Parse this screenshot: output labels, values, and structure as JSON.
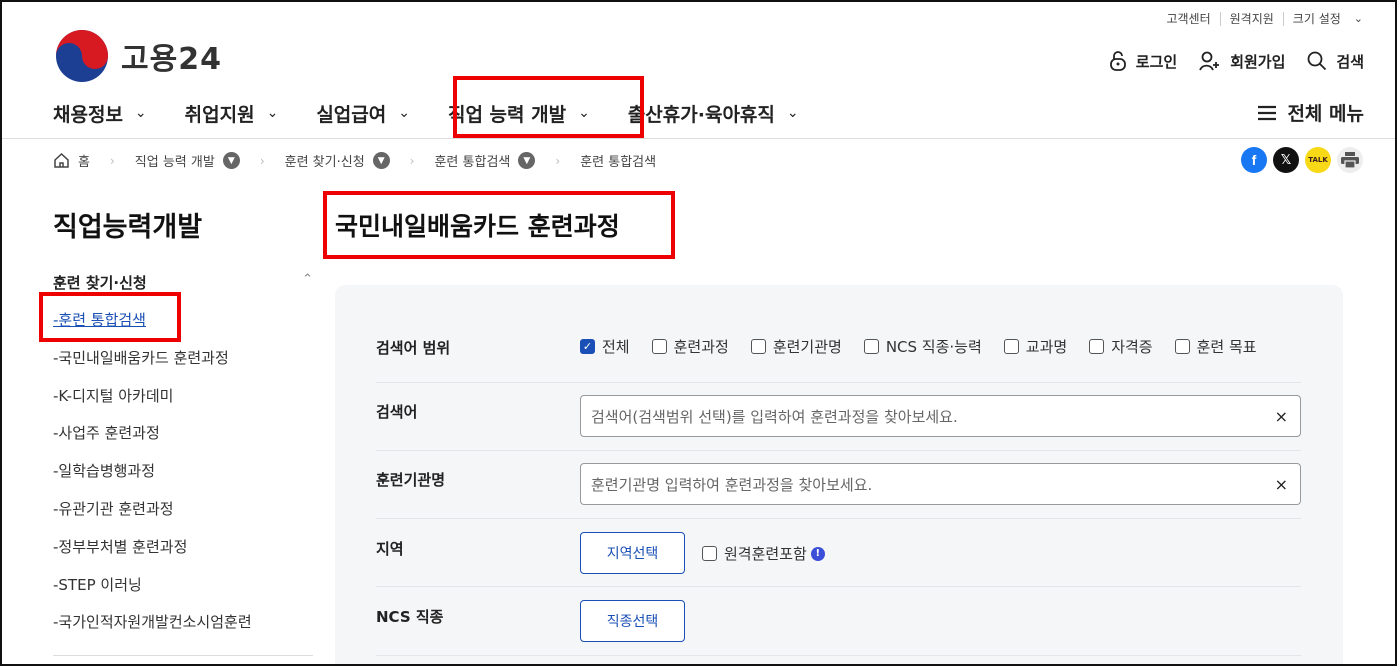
{
  "util": {
    "customer_center": "고객센터",
    "remote_support": "원격지원",
    "size_setting": "크기 설정"
  },
  "logo": {
    "text": "고용24"
  },
  "top_actions": {
    "login": "로그인",
    "signup": "회원가입",
    "search": "검색"
  },
  "gnb": {
    "items": [
      {
        "label": "채용정보"
      },
      {
        "label": "취업지원"
      },
      {
        "label": "실업급여"
      },
      {
        "label": "직업 능력 개발"
      },
      {
        "label": "출산휴가·육아휴직"
      }
    ],
    "all_menu": "전체 메뉴"
  },
  "breadcrumb": {
    "home": "홈",
    "items": [
      "직업 능력 개발",
      "훈련 찾기·신청",
      "훈련 통합검색",
      "훈련 통합검색"
    ]
  },
  "share": {
    "kakao_label": "TALK"
  },
  "lnb": {
    "title": "직업능력개발",
    "section": "훈련 찾기·신청",
    "items": [
      {
        "label": "-훈련 통합검색"
      },
      {
        "label": "-국민내일배움카드 훈련과정"
      },
      {
        "label": "-K-디지털 아카데미"
      },
      {
        "label": "-사업주 훈련과정"
      },
      {
        "label": "-일학습병행과정"
      },
      {
        "label": "-유관기관 훈련과정"
      },
      {
        "label": "-정부부처별 훈련과정"
      },
      {
        "label": "-STEP 이러닝"
      },
      {
        "label": "-국가인적자원개발컨소시엄훈련"
      }
    ]
  },
  "page_title": "국민내일배움카드 훈련과정",
  "form": {
    "scope_label": "검색어 범위",
    "scope_options": [
      {
        "label": "전체",
        "checked": true
      },
      {
        "label": "훈련과정",
        "checked": false
      },
      {
        "label": "훈련기관명",
        "checked": false
      },
      {
        "label": "NCS 직종·능력",
        "checked": false
      },
      {
        "label": "교과명",
        "checked": false
      },
      {
        "label": "자격증",
        "checked": false
      },
      {
        "label": "훈련 목표",
        "checked": false
      }
    ],
    "keyword_label": "검색어",
    "keyword_placeholder": "검색어(검색범위 선택)를 입력하여 훈련과정을 찾아보세요.",
    "institution_label": "훈련기관명",
    "institution_placeholder": "훈련기관명 입력하여 훈련과정을 찾아보세요.",
    "region_label": "지역",
    "region_button": "지역선택",
    "remote_label": "원격훈련포함",
    "ncs_label": "NCS 직종",
    "ncs_button": "직종선택",
    "clear_symbol": "×"
  }
}
